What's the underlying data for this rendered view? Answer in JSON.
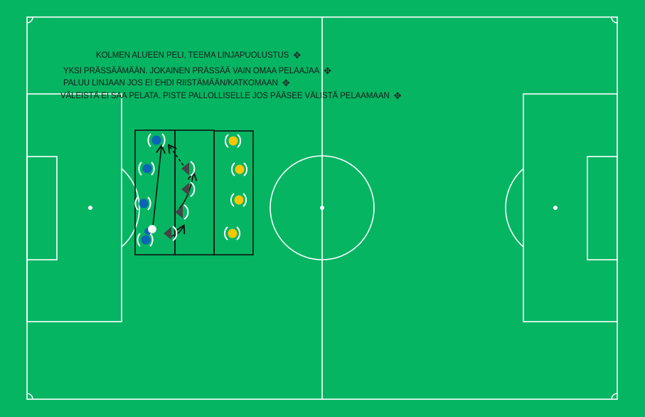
{
  "pitch": {
    "grass_color": "#05b562",
    "line_color": "#ffffff"
  },
  "notes": [
    {
      "text": "KOLMEN ALUEEN PELI, TEEMA LINJAPUOLUSTUS",
      "icon": "move-icon"
    },
    {
      "text": "YKSI PRÄSSÄÄMÄÄN. JOKAINEN PRÄSSÄÄ VAIN OMAA PELAAJAA",
      "icon": "move-icon"
    },
    {
      "text": "PALUU LINJAAN JOS  EI EHDI RIISTÄMÄÄN/KATKOMAAN",
      "icon": "move-icon"
    },
    {
      "text": "VÄLEISTÄ EI SAA PELATA. PISTE PALLOLLISELLE JOS PÄÄSEE VÄLISTÄ PELAAMAAN",
      "icon": "move-icon"
    }
  ],
  "teams": {
    "blue": {
      "color": "#0d63b8",
      "count": 5
    },
    "dark": {
      "color": "#444444",
      "count": 5
    },
    "yellow": {
      "color": "#f7c600",
      "count": 4
    }
  },
  "ball": {
    "color": "#ffffff"
  }
}
